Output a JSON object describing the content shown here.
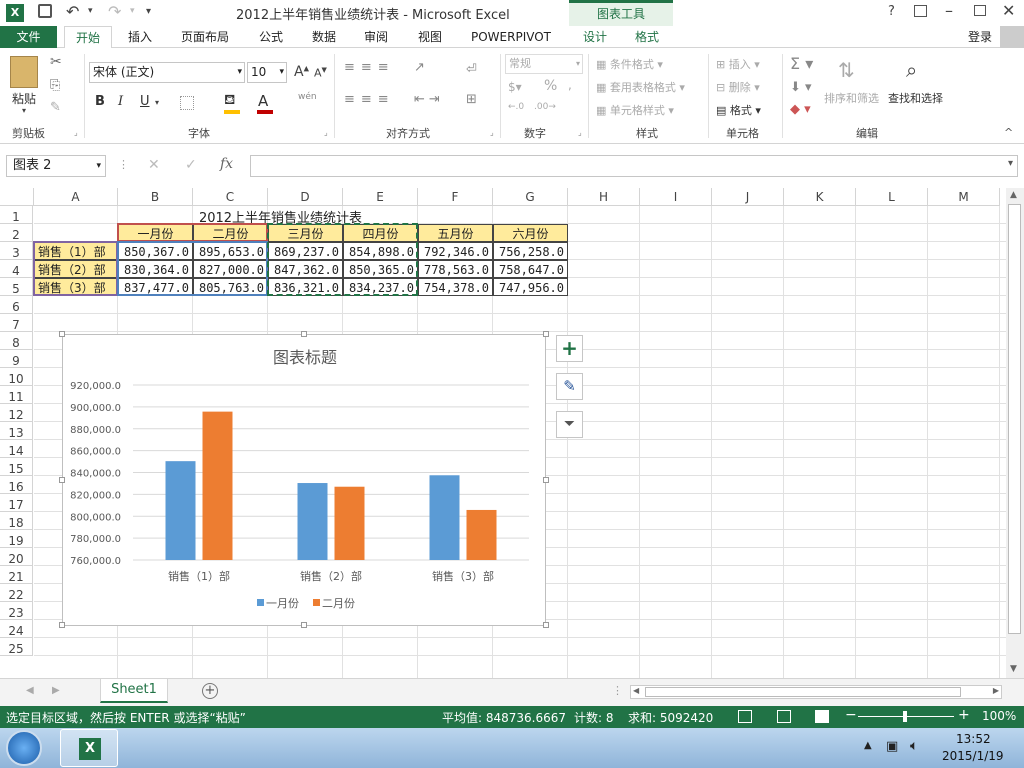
{
  "window": {
    "title": "2012上半年销售业绩统计表 - Microsoft Excel",
    "context_tab_group": "图表工具",
    "help": "?",
    "login": "登录"
  },
  "tabs": {
    "file": "文件",
    "home": "开始",
    "insert": "插入",
    "page_layout": "页面布局",
    "formulas": "公式",
    "data": "数据",
    "review": "审阅",
    "view": "视图",
    "powerpivot": "POWERPIVOT",
    "design": "设计",
    "format": "格式"
  },
  "ribbon": {
    "clipboard": {
      "paste": "粘贴",
      "label": "剪贴板"
    },
    "font": {
      "name": "宋体 (正文)",
      "size": "10",
      "bold": "B",
      "italic": "I",
      "underline": "U",
      "wen": "wén",
      "label": "字体"
    },
    "align": {
      "label": "对齐方式"
    },
    "number": {
      "format": "常规",
      "percent": "%",
      "label": "数字"
    },
    "styles": {
      "conditional": "条件格式",
      "table": "套用表格格式",
      "cell": "单元格样式",
      "label": "样式"
    },
    "cells": {
      "insert": "插入",
      "delete": "删除",
      "format": "格式",
      "label": "单元格"
    },
    "editing": {
      "sort": "排序和筛选",
      "find": "查找和选择",
      "label": "编辑"
    }
  },
  "formula_bar": {
    "name_box": "图表 2",
    "fx": "fx",
    "value": ""
  },
  "columns": [
    "A",
    "B",
    "C",
    "D",
    "E",
    "F",
    "G",
    "H",
    "I",
    "J",
    "K",
    "L",
    "M"
  ],
  "rows": [
    "1",
    "2",
    "3",
    "4",
    "5",
    "6",
    "7",
    "8",
    "9",
    "10",
    "11",
    "12",
    "13",
    "14",
    "15",
    "16",
    "17",
    "18",
    "19",
    "20",
    "21",
    "22",
    "23",
    "24",
    "25"
  ],
  "table": {
    "title": "2012上半年销售业绩统计表",
    "headers": [
      "一月份",
      "二月份",
      "三月份",
      "四月份",
      "五月份",
      "六月份"
    ],
    "rows": [
      {
        "label": "销售（1）部",
        "values": [
          "850,367.0",
          "895,653.0",
          "869,237.0",
          "854,898.0",
          "792,346.0",
          "756,258.0"
        ]
      },
      {
        "label": "销售（2）部",
        "values": [
          "830,364.0",
          "827,000.0",
          "847,362.0",
          "850,365.0",
          "778,563.0",
          "758,647.0"
        ]
      },
      {
        "label": "销售（3）部",
        "values": [
          "837,477.0",
          "805,763.0",
          "836,321.0",
          "834,237.0",
          "754,378.0",
          "747,956.0"
        ]
      }
    ]
  },
  "chart_data": {
    "type": "bar",
    "title": "图表标题",
    "categories": [
      "销售（1）部",
      "销售（2）部",
      "销售（3）部"
    ],
    "series": [
      {
        "name": "一月份",
        "values": [
          850367,
          830364,
          837477
        ],
        "color": "#5b9bd5"
      },
      {
        "name": "二月份",
        "values": [
          895653,
          827000,
          805763
        ],
        "color": "#ed7d31"
      }
    ],
    "ylim": [
      760000,
      920000
    ],
    "yticks": [
      "920,000.0",
      "900,000.0",
      "880,000.0",
      "860,000.0",
      "840,000.0",
      "820,000.0",
      "800,000.0",
      "780,000.0",
      "760,000.0"
    ],
    "legend": "bottom",
    "grid": true
  },
  "sheet_tab": "Sheet1",
  "status": {
    "message": "选定目标区域，然后按 ENTER 或选择“粘贴”",
    "average": "平均值: 848736.6667",
    "count": "计数: 8",
    "sum": "求和: 5092420",
    "zoom": "100%"
  },
  "taskbar": {
    "time": "13:52",
    "date": "2015/1/19"
  },
  "colors": {
    "excel_green": "#217346",
    "header_fill": "#ffeb9c",
    "label_fill": "#ffeb9c"
  }
}
